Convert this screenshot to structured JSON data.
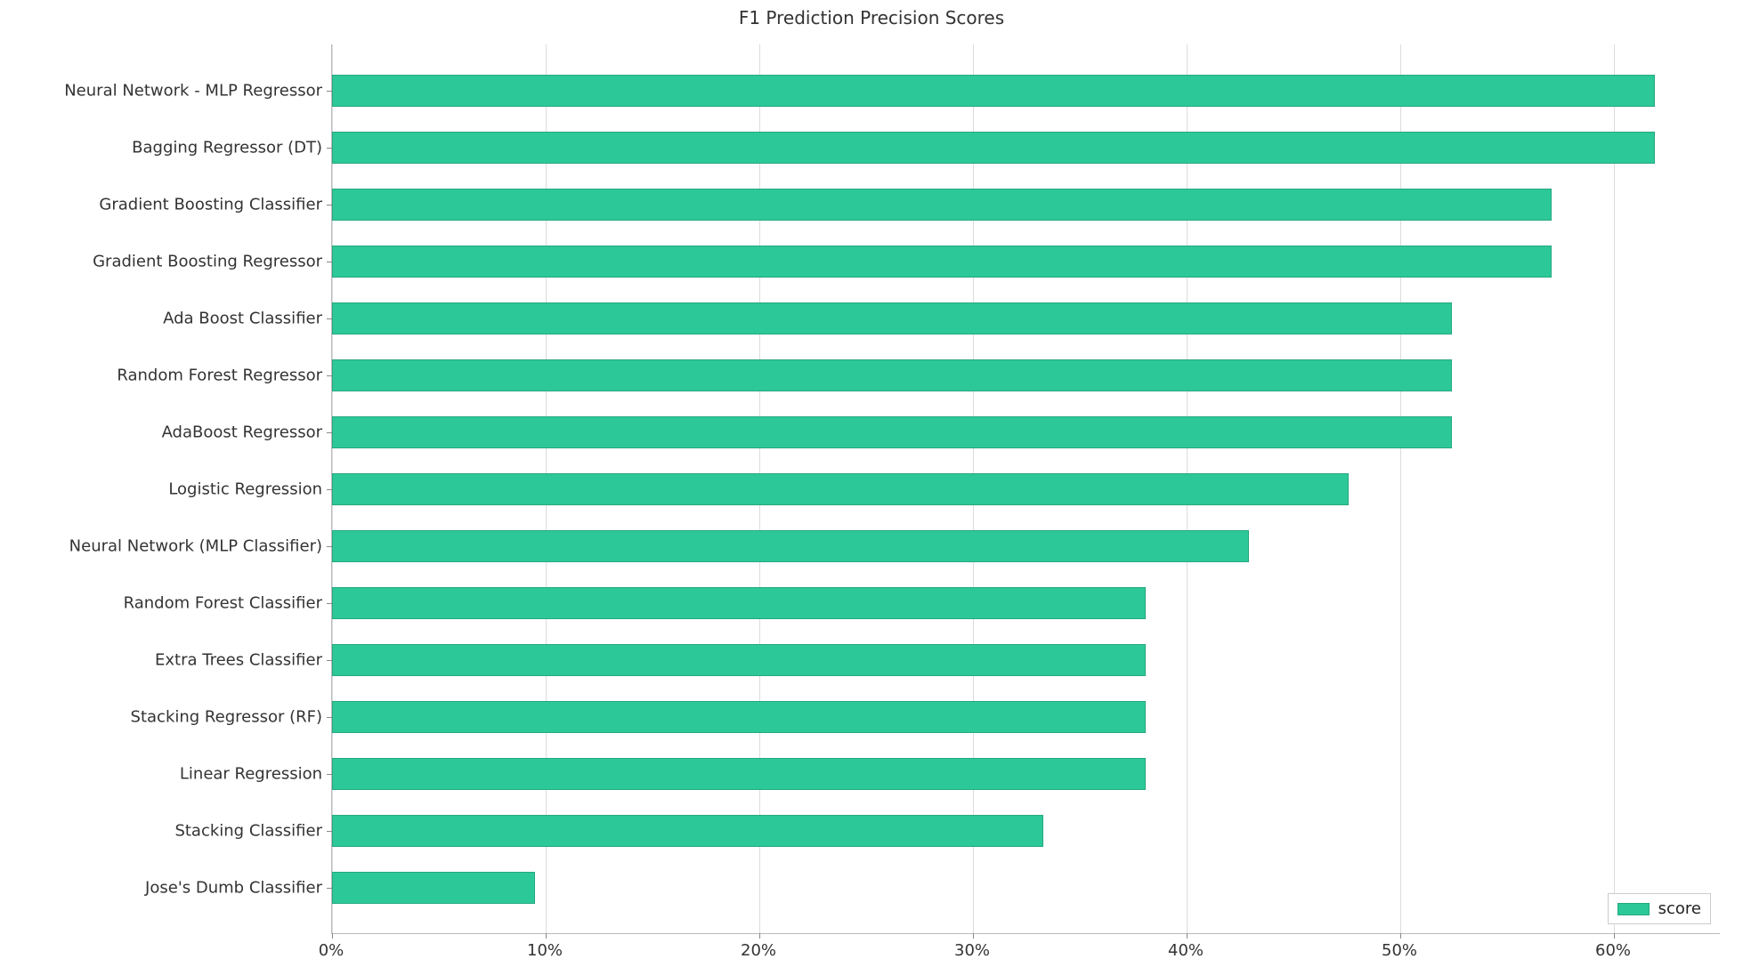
{
  "chart_data": {
    "type": "bar",
    "orientation": "horizontal",
    "title": "F1 Prediction Precision Scores",
    "xlabel": "",
    "ylabel": "",
    "xlim": [
      0,
      65
    ],
    "x_ticks": [
      0,
      10,
      20,
      30,
      40,
      50,
      60
    ],
    "x_tick_labels": [
      "0%",
      "10%",
      "20%",
      "30%",
      "40%",
      "50%",
      "60%"
    ],
    "categories": [
      "Neural Network - MLP Regressor",
      "Bagging Regressor (DT)",
      "Gradient Boosting Classifier",
      "Gradient Boosting Regressor",
      "Ada Boost Classifier",
      "Random Forest Regressor",
      "AdaBoost Regressor",
      "Logistic Regression",
      "Neural Network (MLP Classifier)",
      "Random Forest Classifier",
      "Extra Trees Classifier",
      "Stacking Regressor (RF)",
      "Linear Regression",
      "Stacking Classifier",
      "Jose's Dumb Classifier"
    ],
    "values": [
      61.9,
      61.9,
      57.1,
      57.1,
      52.4,
      52.4,
      52.4,
      47.6,
      42.9,
      38.1,
      38.1,
      38.1,
      38.1,
      33.3,
      9.5
    ],
    "series": [
      {
        "name": "score",
        "values": [
          61.9,
          61.9,
          57.1,
          57.1,
          52.4,
          52.4,
          52.4,
          47.6,
          42.9,
          38.1,
          38.1,
          38.1,
          38.1,
          33.3,
          9.5
        ]
      }
    ],
    "legend": {
      "entries": [
        "score"
      ],
      "position": "lower right"
    },
    "grid": true,
    "bar_color": "#2cc898"
  }
}
